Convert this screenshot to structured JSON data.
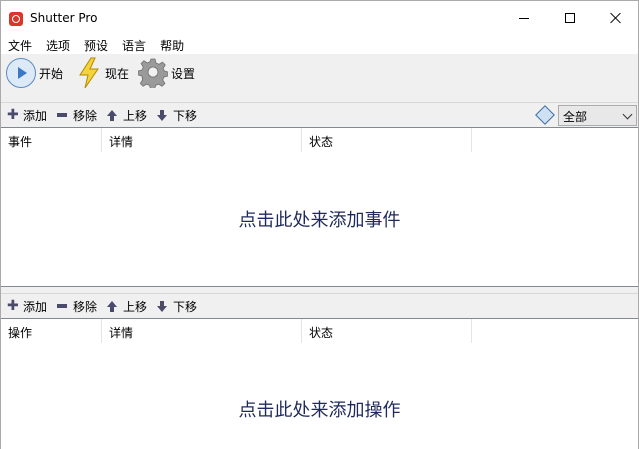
{
  "window": {
    "title": "Shutter Pro"
  },
  "menu": [
    "文件",
    "选项",
    "预设",
    "语言",
    "帮助"
  ],
  "toolbar": {
    "start_label": "开始",
    "now_label": "现在",
    "settings_label": "设置"
  },
  "events_bar": {
    "add": "添加",
    "remove": "移除",
    "move_up": "上移",
    "move_down": "下移",
    "filter_value": "全部"
  },
  "events_table": {
    "columns": [
      "事件",
      "详情",
      "状态"
    ],
    "empty_message": "点击此处来添加事件"
  },
  "actions_bar": {
    "add": "添加",
    "remove": "移除",
    "move_up": "上移",
    "move_down": "下移"
  },
  "actions_table": {
    "columns": [
      "操作",
      "详情",
      "状态"
    ],
    "empty_message": "点击此处来添加操作"
  },
  "colors": {
    "accent": "#3b78c4",
    "empty_text": "#1f2a5c"
  }
}
